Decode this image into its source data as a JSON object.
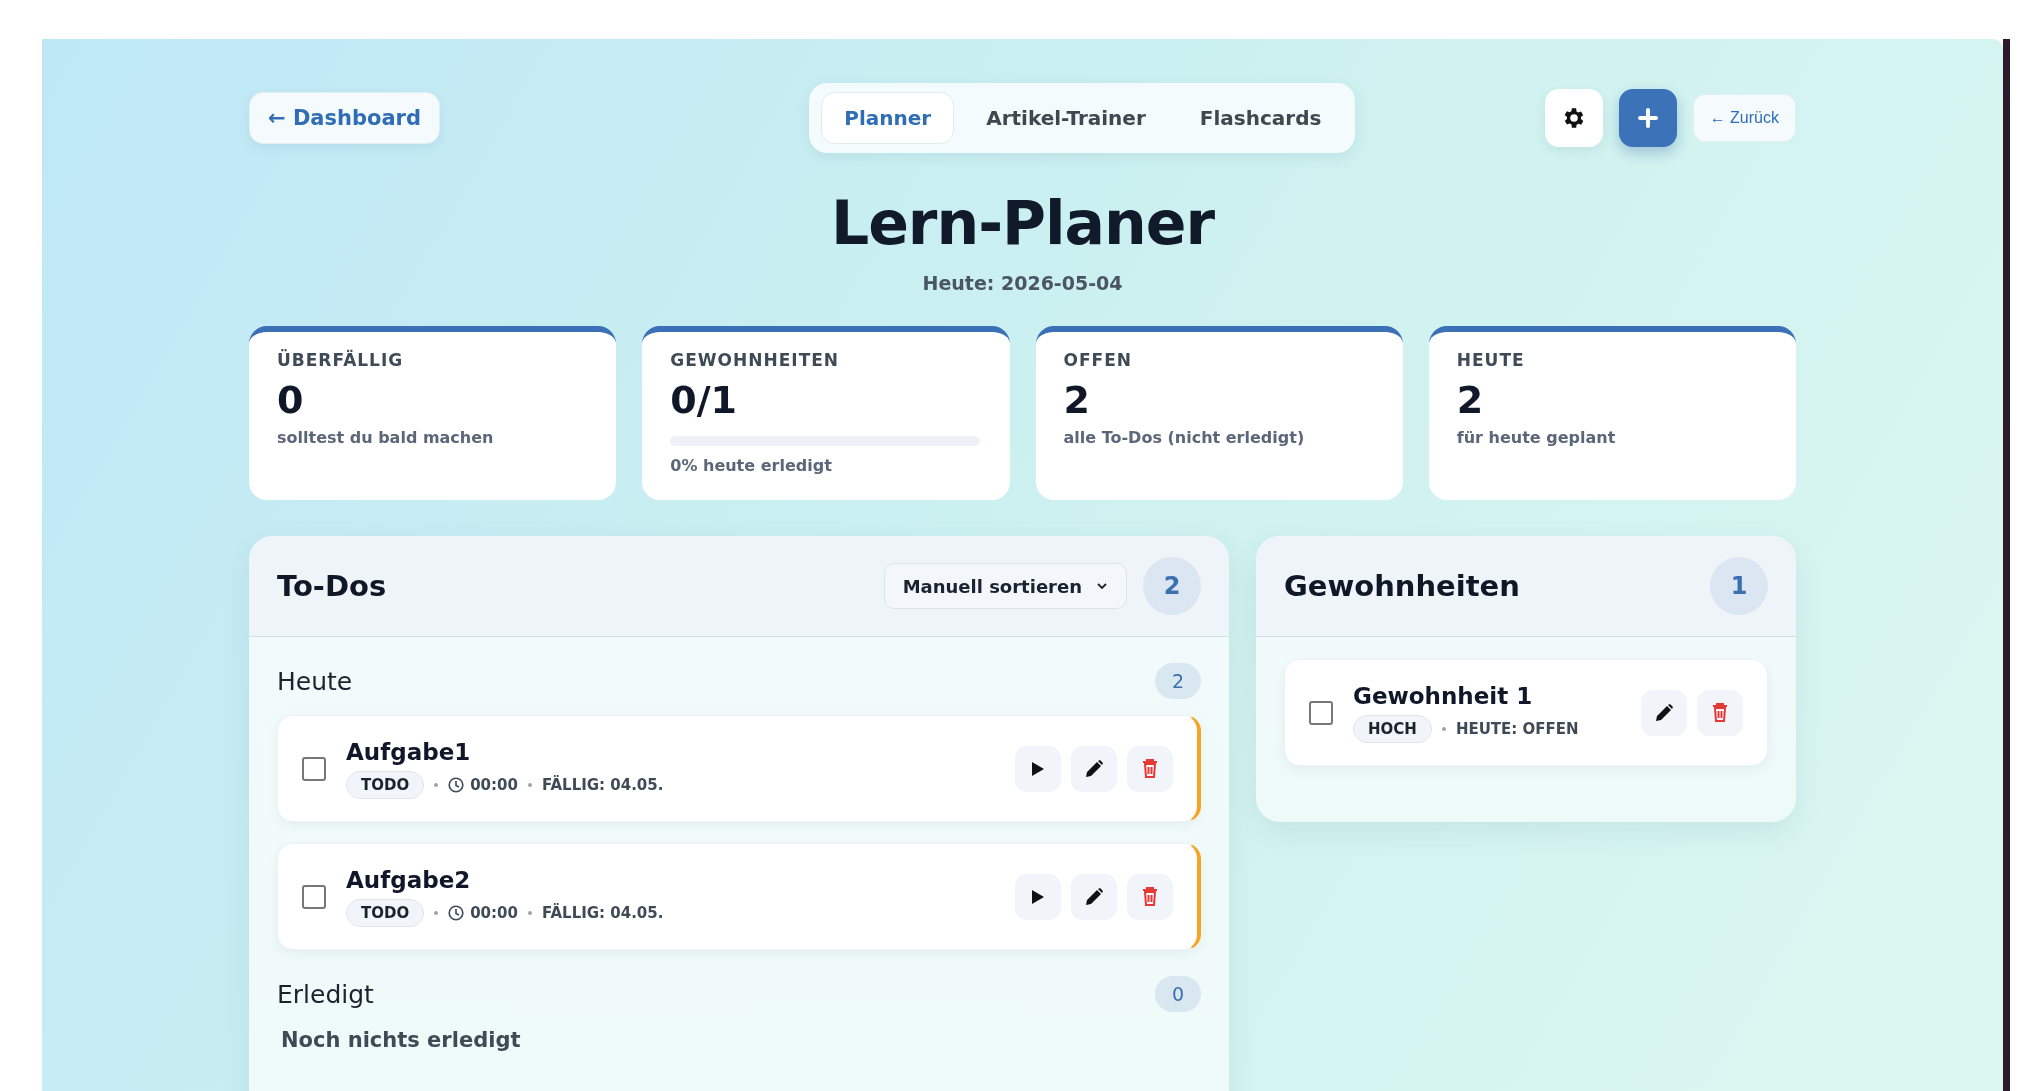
{
  "nav": {
    "back_link": "← Dashboard",
    "tabs": [
      {
        "label": "Planner",
        "selected": true
      },
      {
        "label": "Artikel-Trainer",
        "selected": false
      },
      {
        "label": "Flashcards",
        "selected": false
      }
    ],
    "back_small": "← Zurück"
  },
  "title": "Lern-Planer",
  "subtitle": "Heute: 2026-05-04",
  "stats": [
    {
      "kind": "plain",
      "label": "ÜBERFÄLLIG",
      "value": "0",
      "caption": "solltest du bald machen"
    },
    {
      "kind": "progress",
      "label": "GEWOHNHEITEN",
      "value": "0/1",
      "level": 0,
      "caption": "0% heute erledigt"
    },
    {
      "kind": "plain",
      "label": "OFFEN",
      "value": "2",
      "caption": "alle To-Dos (nicht erledigt)"
    },
    {
      "kind": "plain",
      "label": "HEUTE",
      "value": "2",
      "caption": "für heute geplant"
    }
  ],
  "todos": {
    "title": "To-Dos",
    "sort": "Manuell sortieren",
    "count": "2",
    "sections": [
      {
        "title": "Heute",
        "count": "2",
        "items": [
          {
            "title": "Aufgabe1",
            "checked": false,
            "status": "TODO",
            "time": "00:00",
            "due": "FÄLLIG: 04.05."
          },
          {
            "title": "Aufgabe2",
            "checked": false,
            "status": "TODO",
            "time": "00:00",
            "due": "FÄLLIG: 04.05."
          }
        ]
      },
      {
        "title": "Erledigt",
        "count": "0",
        "empty": "Noch nichts erledigt"
      }
    ]
  },
  "habits": {
    "title": "Gewohnheiten",
    "count": "1",
    "items": [
      {
        "title": "Gewohnheit 1",
        "checked": false,
        "priority": "HOCH",
        "status": "HEUTE: OFFEN"
      }
    ]
  }
}
